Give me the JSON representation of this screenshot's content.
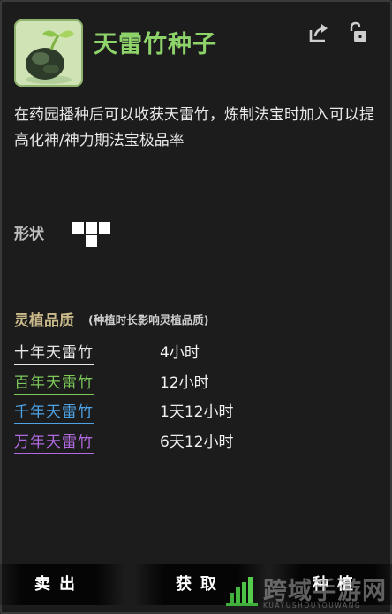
{
  "item": {
    "icon": "seed-sprout-icon",
    "title": "天雷竹种子",
    "title_color": "#8ed26a",
    "description": "在药园播种后可以收获天雷竹，炼制法宝时加入可以提高化神/神力期法宝极品率"
  },
  "header_icons": {
    "share": "share-icon",
    "lock": "unlock-icon"
  },
  "shape": {
    "label": "形状"
  },
  "quality": {
    "title": "灵植品质",
    "title_color": "#c9b98a",
    "subtitle": "(种植时长影响灵植品质)",
    "rows": [
      {
        "name": "十年天雷竹",
        "time": "4小时",
        "color": "#e8e8e8"
      },
      {
        "name": "百年天雷竹",
        "time": "12小时",
        "color": "#7cc95a"
      },
      {
        "name": "千年天雷竹",
        "time": "1天12小时",
        "color": "#4ea3e6"
      },
      {
        "name": "万年天雷竹",
        "time": "6天12小时",
        "color": "#b26ae0"
      }
    ]
  },
  "buttons": {
    "sell": "卖出",
    "obtain": "获取",
    "plant": "种植"
  },
  "watermark": {
    "main": "跨域手游网",
    "sub": "KUAYUSHOUYOUWANG"
  }
}
